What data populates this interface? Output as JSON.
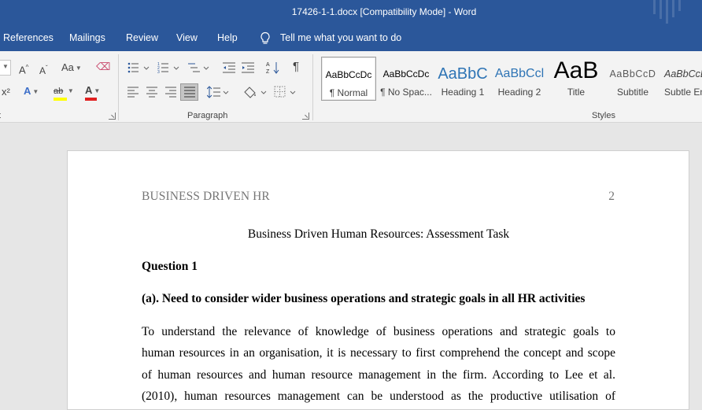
{
  "window": {
    "title": "17426-1-1.docx [Compatibility Mode]  -  Word"
  },
  "menu": {
    "tabs": [
      "References",
      "Mailings",
      "Review",
      "View",
      "Help"
    ],
    "tell_me": "Tell me what you want to do"
  },
  "ribbon": {
    "font_group_label": "t",
    "paragraph_group_label": "Paragraph",
    "styles_group_label": "Styles",
    "font_buttons": {
      "grow": "A",
      "shrink": "A",
      "change_case": "Aa",
      "superscript": "x²",
      "text_effects": "A",
      "highlight": "ab",
      "font_color": "A"
    },
    "pilcrow": "¶",
    "styles": [
      {
        "sample": "AaBbCcDc",
        "name": "¶ Normal",
        "active": true
      },
      {
        "sample": "AaBbCcDc",
        "name": "¶ No Spac..."
      },
      {
        "sample": "AaBbC",
        "name": "Heading 1"
      },
      {
        "sample": "AaBbCcl",
        "name": "Heading 2"
      },
      {
        "sample": "AaB",
        "name": "Title"
      },
      {
        "sample": "AaBbCcD",
        "name": "Subtitle"
      },
      {
        "sample": "AaBbCcD",
        "name": "Subtle Em"
      }
    ],
    "colors": {
      "highlight": "#ffff00",
      "font_color": "#e02020",
      "heading_blue": "#2e74b5",
      "accent": "#2b579a"
    }
  },
  "document": {
    "running_head": "BUSINESS DRIVEN HR",
    "page_number": "2",
    "title": "Business Driven Human Resources: Assessment Task",
    "question": "Question 1",
    "subheading": "(a). Need to consider wider business operations and strategic goals in all HR activities",
    "body_lines": [
      "To understand the relevance of knowledge of business operations and strategic goals to",
      "human resources in an organisation, it is necessary to first comprehend the concept and scope",
      "of human resources and human resource management in the firm. According to Lee et al.",
      "(2010), human resources management can be understood as the productive utilisation of"
    ]
  }
}
